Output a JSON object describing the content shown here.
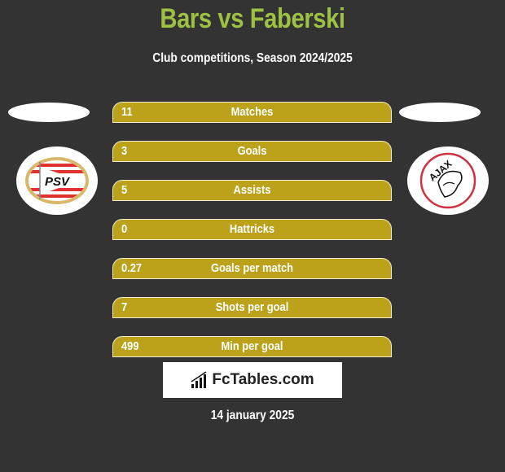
{
  "header": {
    "title": "Bars vs Faberski",
    "subtitle": "Club competitions, Season 2024/2025"
  },
  "teams": {
    "left": {
      "logo": "psv-logo",
      "logo_text": "PSV"
    },
    "right": {
      "logo": "ajax-logo",
      "logo_text": "AJAX"
    }
  },
  "colors": {
    "background": "#333333",
    "title": "#9dc142",
    "bar": "#bba21a"
  },
  "stats": [
    {
      "value": "11",
      "label": "Matches"
    },
    {
      "value": "3",
      "label": "Goals"
    },
    {
      "value": "5",
      "label": "Assists"
    },
    {
      "value": "0",
      "label": "Hattricks"
    },
    {
      "value": "0.27",
      "label": "Goals per match"
    },
    {
      "value": "7",
      "label": "Shots per goal"
    },
    {
      "value": "499",
      "label": "Min per goal"
    }
  ],
  "brand": {
    "icon": "bar-chart-icon",
    "text": "FcTables.com"
  },
  "footer": {
    "date": "14 january 2025"
  }
}
